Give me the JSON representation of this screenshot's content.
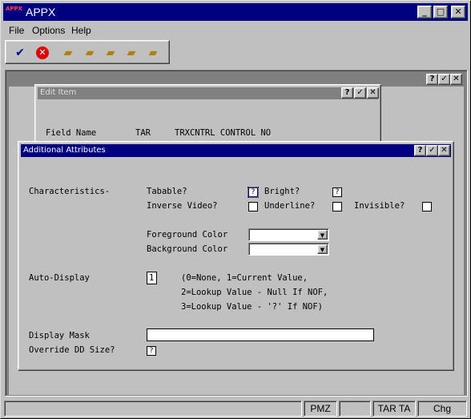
{
  "window": {
    "title": "APPX",
    "logo_text": "APPX",
    "minimize": "_",
    "maximize": "□",
    "close": "✕"
  },
  "menu": {
    "items": [
      {
        "label": "File"
      },
      {
        "label": "Options"
      },
      {
        "label": "Help"
      }
    ]
  },
  "toolbar": {
    "icons": [
      "check-icon",
      "cancel-icon",
      "folder-icon",
      "folder-edit-icon",
      "folder-search-icon",
      "folder-delete-icon",
      "folder-clear-icon"
    ]
  },
  "mdi": {
    "help": "?",
    "ok": "✓",
    "close": "✕"
  },
  "edit_item": {
    "title": "Edit Item",
    "help": "?",
    "ok": "✓",
    "close": "✕",
    "field_name_label": "Field Name",
    "field_app": "TAR",
    "field_value": "TRXCNTRL CONTROL NO"
  },
  "dialog": {
    "title": "Additional Attributes",
    "help": "?",
    "ok": "✓",
    "close": "✕",
    "characteristics_label": "Characteristics-",
    "tabable_label": "Tabable?",
    "tabable_value": "?",
    "bright_label": "Bright?",
    "bright_value": "?",
    "inverse_label": "Inverse Video?",
    "underline_label": "Underline?",
    "invisible_label": "Invisible?",
    "fg_color_label": "Foreground Color",
    "bg_color_label": "Background Color",
    "fg_color_value": "",
    "bg_color_value": "",
    "auto_display_label": "Auto-Display",
    "auto_display_value": "1",
    "auto_display_hint_1": "(0=None, 1=Current Value,",
    "auto_display_hint_2": "2=Lookup Value - Null If NOF,",
    "auto_display_hint_3": "3=Lookup Value - '?' If NOF)",
    "display_mask_label": "Display Mask",
    "display_mask_value": "",
    "override_label": "Override DD Size?",
    "override_value": "?"
  },
  "status": {
    "panels": [
      "",
      "PMZ",
      "",
      "TAR TA",
      "Chg"
    ]
  }
}
